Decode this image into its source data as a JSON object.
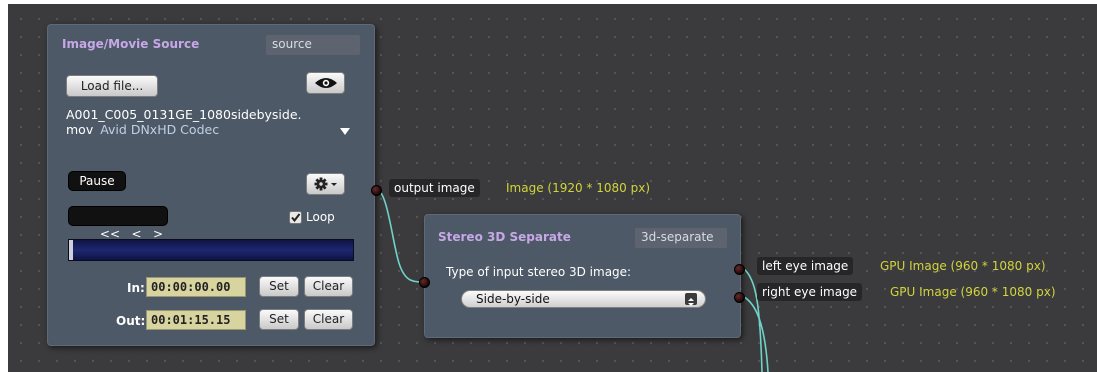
{
  "source_node": {
    "title": "Image/Movie Source",
    "id": "source",
    "load_button": "Load file...",
    "file_name_line1": "A001_C005_0131GE_1080sidebyside.",
    "file_name_line2": "mov",
    "codec": "Avid DNxHD Codec",
    "pause_button": "Pause",
    "transport_label": "<<   <   >",
    "loop_label": "Loop",
    "loop_checked": true,
    "playback_progress": 0,
    "in_label": "In:",
    "in_time": "00:00:00.00",
    "out_label": "Out:",
    "out_time": "00:01:15.15",
    "set_label": "Set",
    "clear_label": "Clear",
    "output_port": "output image",
    "output_type": "Image (1920 * 1080 px)"
  },
  "separate_node": {
    "title": "Stereo 3D Separate",
    "id": "3d-separate",
    "input_label": "Type of input stereo 3D image:",
    "input_value": "Side-by-side",
    "outputs": [
      {
        "label": "left eye image",
        "type": "GPU Image (960 * 1080 px)"
      },
      {
        "label": "right eye image",
        "type": "GPU Image (960 * 1080 px)"
      }
    ]
  },
  "colors": {
    "canvas": "#3b3b3d",
    "node": "#4d5966",
    "title": "#c7a8e6",
    "type_text": "#d2d43c",
    "connection": "#6fd3c7"
  },
  "icons": [
    "eye-icon",
    "gear-icon",
    "chevron-down-icon",
    "checkbox-icon",
    "stepper-icon"
  ]
}
